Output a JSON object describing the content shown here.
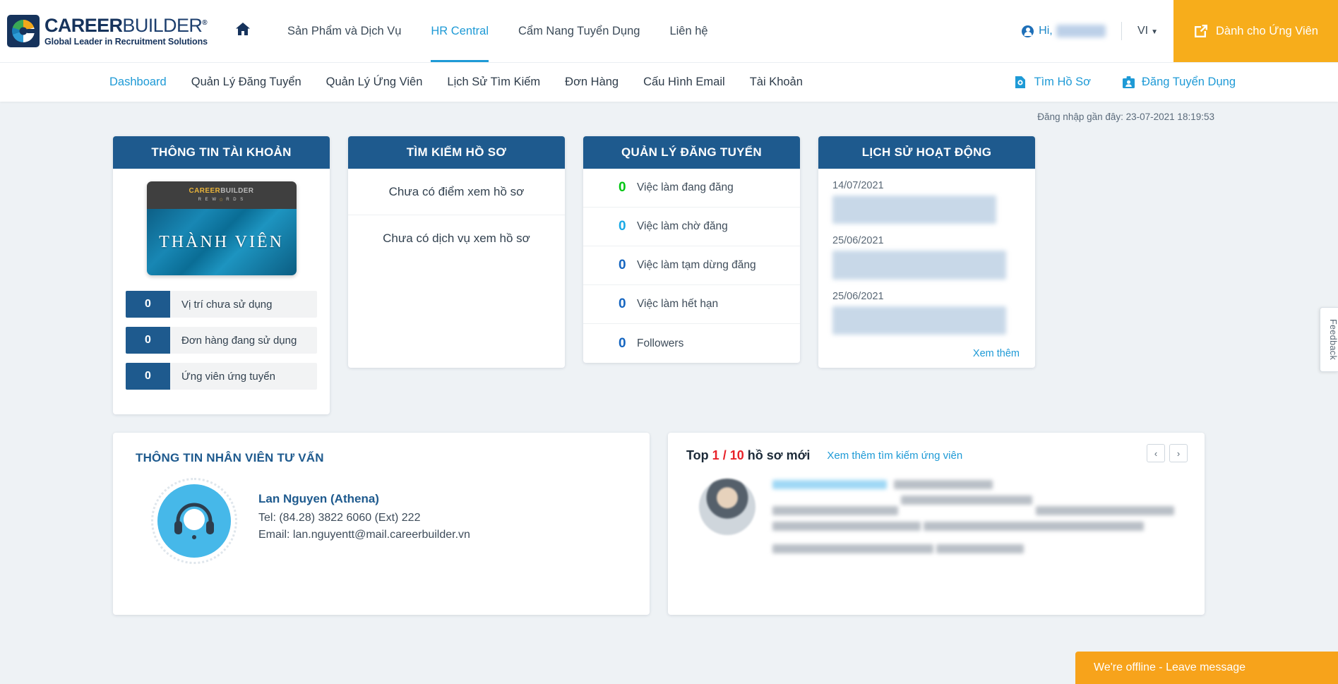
{
  "header": {
    "logo_name_bold": "CAREER",
    "logo_name_light": "BUILDER",
    "logo_tagline": "Global Leader in Recruitment Solutions",
    "home_icon": "home-icon",
    "nav": [
      {
        "label": "Sản Phẩm và Dịch Vụ",
        "active": false
      },
      {
        "label": "HR Central",
        "active": true
      },
      {
        "label": "Cẩm Nang Tuyển Dụng",
        "active": false
      },
      {
        "label": "Liên hệ",
        "active": false
      }
    ],
    "greeting": "Hi,",
    "username_redacted": "redacted",
    "language": "VI",
    "cta_label": "Dành cho Ứng Viên",
    "cta_color": "#f7ad1b"
  },
  "subnav": {
    "items": [
      {
        "label": "Dashboard",
        "active": true
      },
      {
        "label": "Quản Lý Đăng Tuyển",
        "active": false
      },
      {
        "label": "Quản Lý Ứng Viên",
        "active": false
      },
      {
        "label": "Lịch Sử Tìm Kiếm",
        "active": false
      },
      {
        "label": "Đơn Hàng",
        "active": false
      },
      {
        "label": "Cấu Hình Email",
        "active": false
      },
      {
        "label": "Tài Khoản",
        "active": false
      }
    ],
    "actions": [
      {
        "label": "Tìm Hồ Sơ",
        "icon": "resume-search-icon"
      },
      {
        "label": "Đăng Tuyển Dụng",
        "icon": "post-job-icon"
      }
    ]
  },
  "login_info": "Đăng nhập gần đây: 23-07-2021 18:19:53",
  "cards": {
    "account": {
      "title": "THÔNG TIN TÀI KHOẢN",
      "member_card": {
        "brand_bold": "CAREER",
        "brand_light": "BUILDER",
        "rewards_left": "R E W",
        "rewards_star": "☆",
        "rewards_right": "R D S",
        "tier": "THÀNH VIÊN"
      },
      "stats": [
        {
          "value": "0",
          "label": "Vị trí chưa sử dụng"
        },
        {
          "value": "0",
          "label": "Đơn hàng đang sử dụng"
        },
        {
          "value": "0",
          "label": "Ứng viên ứng tuyển"
        }
      ]
    },
    "search": {
      "title": "TÌM KIẾM HỒ SƠ",
      "lines": [
        "Chưa có điểm xem hồ sơ",
        "Chưa có dịch vụ xem hồ sơ"
      ]
    },
    "postings": {
      "title": "QUẢN LÝ ĐĂNG TUYỂN",
      "rows": [
        {
          "value": "0",
          "label": "Việc làm đang đăng",
          "color": "#00c612"
        },
        {
          "value": "0",
          "label": "Việc làm chờ đăng",
          "color": "#19a9e6"
        },
        {
          "value": "0",
          "label": "Việc làm tạm dừng đăng",
          "color": "#1565c0"
        },
        {
          "value": "0",
          "label": "Việc làm hết hạn",
          "color": "#1565c0"
        },
        {
          "value": "0",
          "label": "Followers",
          "color": "#1565c0"
        }
      ]
    },
    "activity": {
      "title": "LỊCH SỬ HOẠT ĐỘNG",
      "items": [
        {
          "date": "14/07/2021",
          "detail_redacted": "Name Company: CareerBuilder Viet Nam"
        },
        {
          "date": "25/06/2021",
          "detail_redacted": "Change Contact Information at 11:40:55:25 06 2021"
        },
        {
          "date": "25/06/2021",
          "detail_redacted": "Change Contact Information at 11:40:55:25 06 2021"
        }
      ],
      "more_label": "Xem thêm"
    }
  },
  "consultant": {
    "title": "THÔNG TIN NHÂN VIÊN TƯ VẤN",
    "avatar_icon": "headset-icon",
    "name": "Lan Nguyen (Athena)",
    "tel": "Tel: (84.28) 3822 6060 (Ext) 222",
    "email": "Email: lan.nguyentt@mail.careerbuilder.vn"
  },
  "top_profiles": {
    "title_prefix": "Top",
    "current": "1",
    "separator": "/",
    "total": "10",
    "title_suffix": "hồ sơ mới",
    "more_link": "Xem thêm tìm kiếm ứng viên",
    "prev_icon": "chevron-left-icon",
    "next_icon": "chevron-right-icon",
    "candidate_redacted": {
      "name": "nguyen ai viet nam",
      "date": "Ngày: 14-11-2017 09:38:12",
      "lines": [
        "Marketing Director/Manager",
        "Năm kinh nghiệm: Trên 10 năm",
        "Bằng cấp cao nhất: Sau đại học",
        "Mức lương mong muốn: Thỏa thuận",
        "Ngành nghề mong muốn: Thực phẩm & Đồ uống, Hàng gia dụng /",
        "Chăm sóc cá nhân, Tiếp thị / Marketing",
        "Địa điểm: Hồ Chí Minh"
      ]
    }
  },
  "feedback_tab": "Feedback",
  "chat": {
    "message": "We're offline - Leave message",
    "color": "#f7a31b"
  }
}
